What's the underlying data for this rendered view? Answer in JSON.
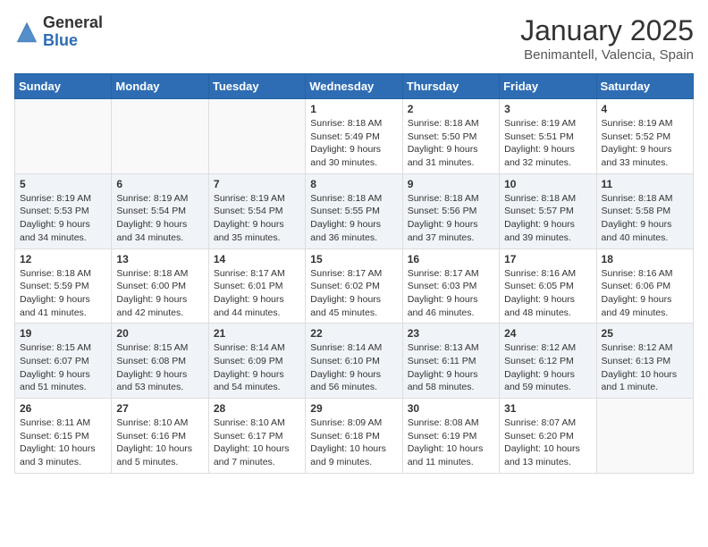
{
  "logo": {
    "general": "General",
    "blue": "Blue"
  },
  "title": "January 2025",
  "location": "Benimantell, Valencia, Spain",
  "weekdays": [
    "Sunday",
    "Monday",
    "Tuesday",
    "Wednesday",
    "Thursday",
    "Friday",
    "Saturday"
  ],
  "weeks": [
    [
      {
        "day": "",
        "info": ""
      },
      {
        "day": "",
        "info": ""
      },
      {
        "day": "",
        "info": ""
      },
      {
        "day": "1",
        "info": "Sunrise: 8:18 AM\nSunset: 5:49 PM\nDaylight: 9 hours and 30 minutes."
      },
      {
        "day": "2",
        "info": "Sunrise: 8:18 AM\nSunset: 5:50 PM\nDaylight: 9 hours and 31 minutes."
      },
      {
        "day": "3",
        "info": "Sunrise: 8:19 AM\nSunset: 5:51 PM\nDaylight: 9 hours and 32 minutes."
      },
      {
        "day": "4",
        "info": "Sunrise: 8:19 AM\nSunset: 5:52 PM\nDaylight: 9 hours and 33 minutes."
      }
    ],
    [
      {
        "day": "5",
        "info": "Sunrise: 8:19 AM\nSunset: 5:53 PM\nDaylight: 9 hours and 34 minutes."
      },
      {
        "day": "6",
        "info": "Sunrise: 8:19 AM\nSunset: 5:54 PM\nDaylight: 9 hours and 34 minutes."
      },
      {
        "day": "7",
        "info": "Sunrise: 8:19 AM\nSunset: 5:54 PM\nDaylight: 9 hours and 35 minutes."
      },
      {
        "day": "8",
        "info": "Sunrise: 8:18 AM\nSunset: 5:55 PM\nDaylight: 9 hours and 36 minutes."
      },
      {
        "day": "9",
        "info": "Sunrise: 8:18 AM\nSunset: 5:56 PM\nDaylight: 9 hours and 37 minutes."
      },
      {
        "day": "10",
        "info": "Sunrise: 8:18 AM\nSunset: 5:57 PM\nDaylight: 9 hours and 39 minutes."
      },
      {
        "day": "11",
        "info": "Sunrise: 8:18 AM\nSunset: 5:58 PM\nDaylight: 9 hours and 40 minutes."
      }
    ],
    [
      {
        "day": "12",
        "info": "Sunrise: 8:18 AM\nSunset: 5:59 PM\nDaylight: 9 hours and 41 minutes."
      },
      {
        "day": "13",
        "info": "Sunrise: 8:18 AM\nSunset: 6:00 PM\nDaylight: 9 hours and 42 minutes."
      },
      {
        "day": "14",
        "info": "Sunrise: 8:17 AM\nSunset: 6:01 PM\nDaylight: 9 hours and 44 minutes."
      },
      {
        "day": "15",
        "info": "Sunrise: 8:17 AM\nSunset: 6:02 PM\nDaylight: 9 hours and 45 minutes."
      },
      {
        "day": "16",
        "info": "Sunrise: 8:17 AM\nSunset: 6:03 PM\nDaylight: 9 hours and 46 minutes."
      },
      {
        "day": "17",
        "info": "Sunrise: 8:16 AM\nSunset: 6:05 PM\nDaylight: 9 hours and 48 minutes."
      },
      {
        "day": "18",
        "info": "Sunrise: 8:16 AM\nSunset: 6:06 PM\nDaylight: 9 hours and 49 minutes."
      }
    ],
    [
      {
        "day": "19",
        "info": "Sunrise: 8:15 AM\nSunset: 6:07 PM\nDaylight: 9 hours and 51 minutes."
      },
      {
        "day": "20",
        "info": "Sunrise: 8:15 AM\nSunset: 6:08 PM\nDaylight: 9 hours and 53 minutes."
      },
      {
        "day": "21",
        "info": "Sunrise: 8:14 AM\nSunset: 6:09 PM\nDaylight: 9 hours and 54 minutes."
      },
      {
        "day": "22",
        "info": "Sunrise: 8:14 AM\nSunset: 6:10 PM\nDaylight: 9 hours and 56 minutes."
      },
      {
        "day": "23",
        "info": "Sunrise: 8:13 AM\nSunset: 6:11 PM\nDaylight: 9 hours and 58 minutes."
      },
      {
        "day": "24",
        "info": "Sunrise: 8:12 AM\nSunset: 6:12 PM\nDaylight: 9 hours and 59 minutes."
      },
      {
        "day": "25",
        "info": "Sunrise: 8:12 AM\nSunset: 6:13 PM\nDaylight: 10 hours and 1 minute."
      }
    ],
    [
      {
        "day": "26",
        "info": "Sunrise: 8:11 AM\nSunset: 6:15 PM\nDaylight: 10 hours and 3 minutes."
      },
      {
        "day": "27",
        "info": "Sunrise: 8:10 AM\nSunset: 6:16 PM\nDaylight: 10 hours and 5 minutes."
      },
      {
        "day": "28",
        "info": "Sunrise: 8:10 AM\nSunset: 6:17 PM\nDaylight: 10 hours and 7 minutes."
      },
      {
        "day": "29",
        "info": "Sunrise: 8:09 AM\nSunset: 6:18 PM\nDaylight: 10 hours and 9 minutes."
      },
      {
        "day": "30",
        "info": "Sunrise: 8:08 AM\nSunset: 6:19 PM\nDaylight: 10 hours and 11 minutes."
      },
      {
        "day": "31",
        "info": "Sunrise: 8:07 AM\nSunset: 6:20 PM\nDaylight: 10 hours and 13 minutes."
      },
      {
        "day": "",
        "info": ""
      }
    ]
  ]
}
